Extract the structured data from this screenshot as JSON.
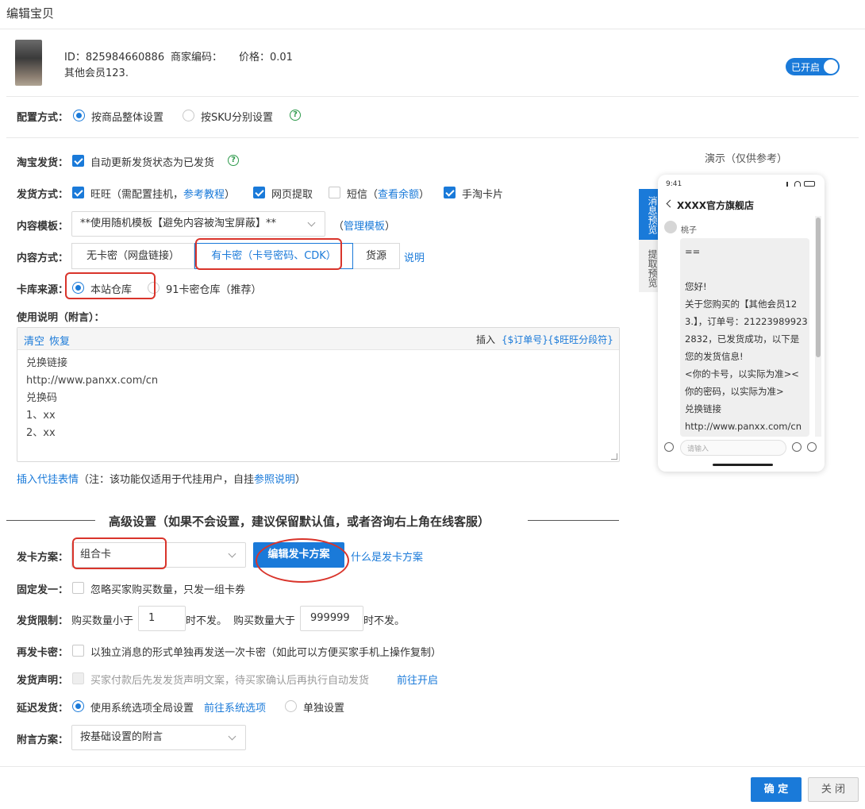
{
  "window": {
    "title": "编辑宝贝"
  },
  "product": {
    "id_text": "ID：825984660886",
    "merchant_code_label": "商家编码：",
    "price_text": "价格：0.01",
    "name": "其他会员123.",
    "toggle_label": "已开启"
  },
  "config": {
    "label": "配置方式：",
    "option_whole": "按商品整体设置",
    "option_sku": "按SKU分别设置",
    "help": "?"
  },
  "taobao_ship": {
    "label": "淘宝发货：",
    "text": "自动更新发货状态为已发货",
    "help": "?"
  },
  "ship_method": {
    "label": "发货方式：",
    "wangwang": "旺旺（需配置挂机，",
    "tutorial_link": "参考教程",
    "close_paren": "）",
    "web_extract": "网页提取",
    "sms": "短信（",
    "balance_link": "查看余额",
    "sms_close": "）",
    "mobile_card": "手淘卡片"
  },
  "template": {
    "label": "内容模板：",
    "selected": "**使用随机模板【避免内容被淘宝屏蔽】**",
    "manage_open": "（",
    "manage_link": "管理模板",
    "manage_close": "）"
  },
  "content_method": {
    "label": "内容方式：",
    "tabs": [
      "无卡密（网盘链接）",
      "有卡密（卡号密码、CDK）",
      "货源"
    ],
    "explain_link": "说明"
  },
  "stock_source": {
    "label": "卡库来源：",
    "option_local": "本站仓库",
    "option_91": "91卡密仓库（推荐）"
  },
  "instructions": {
    "label": "使用说明（附言）：",
    "clear": "清空",
    "restore": "恢复",
    "insert_label": "插入",
    "insert_order": "{$订单号}",
    "insert_ww": "{$旺旺分段符}",
    "lines": [
      "兑换链接",
      "http://www.panxx.com/cn",
      "兑换码",
      "1、xx",
      "2、xx"
    ]
  },
  "emoji_insert": {
    "link": "插入代挂表情",
    "note": "（注：该功能仅适用于代挂用户，自挂",
    "ref_link": "参照说明",
    "close": "）"
  },
  "advanced": {
    "title": "高级设置（如果不会设置，建议保留默认值，或者咨询右上角在线客服）"
  },
  "card_plan": {
    "label": "发卡方案：",
    "selected": "组合卡",
    "edit_button": "编辑发卡方案",
    "what_link": "什么是发卡方案"
  },
  "fixed_one": {
    "label": "固定发一：",
    "text": "忽略买家购买数量，只发一组卡券"
  },
  "limit": {
    "label": "发货限制：",
    "less_prefix": "购买数量小于",
    "min_value": "1",
    "less_suffix": "时不发。",
    "more_prefix": "购买数量大于",
    "max_value": "999999",
    "more_suffix": "时不发。"
  },
  "resend": {
    "label": "再发卡密：",
    "text": "以独立消息的形式单独再发送一次卡密（如此可以方便买家手机上操作复制）"
  },
  "declaration": {
    "label": "发货声明：",
    "text": "买家付款后先发发货声明文案，待买家确认后再执行自动发货",
    "link": "前往开启"
  },
  "delay": {
    "label": "延迟发货：",
    "option_system": "使用系统选项全局设置",
    "system_link": "前往系统选项",
    "option_single": "单独设置"
  },
  "postscript": {
    "label": "附言方案：",
    "selected": "按基础设置的附言"
  },
  "footer": {
    "confirm": "确 定",
    "close": "关 闭"
  },
  "preview": {
    "title": "演示（仅供参考）",
    "tab_message": "消息预览",
    "tab_extract": "提取预览",
    "time": "9:41",
    "shop_name": "XXXX官方旗舰店",
    "sender": "桃子",
    "bubble_lines": [
      "==",
      "",
      "您好!",
      "关于您购买的【其他会员12",
      "3.】，订单号：21223989923",
      "2832，已发货成功，以下是",
      "您的发货信息!",
      "<你的卡号，以实际为准><",
      "你的密码，以实际为准>",
      "兑换链接",
      "http://www.panxx.com/cn"
    ],
    "input_placeholder": "请输入"
  },
  "colors": {
    "accent": "#1a7ad9",
    "annotation_red": "#d9342b",
    "help_green": "#2e9a4c"
  }
}
